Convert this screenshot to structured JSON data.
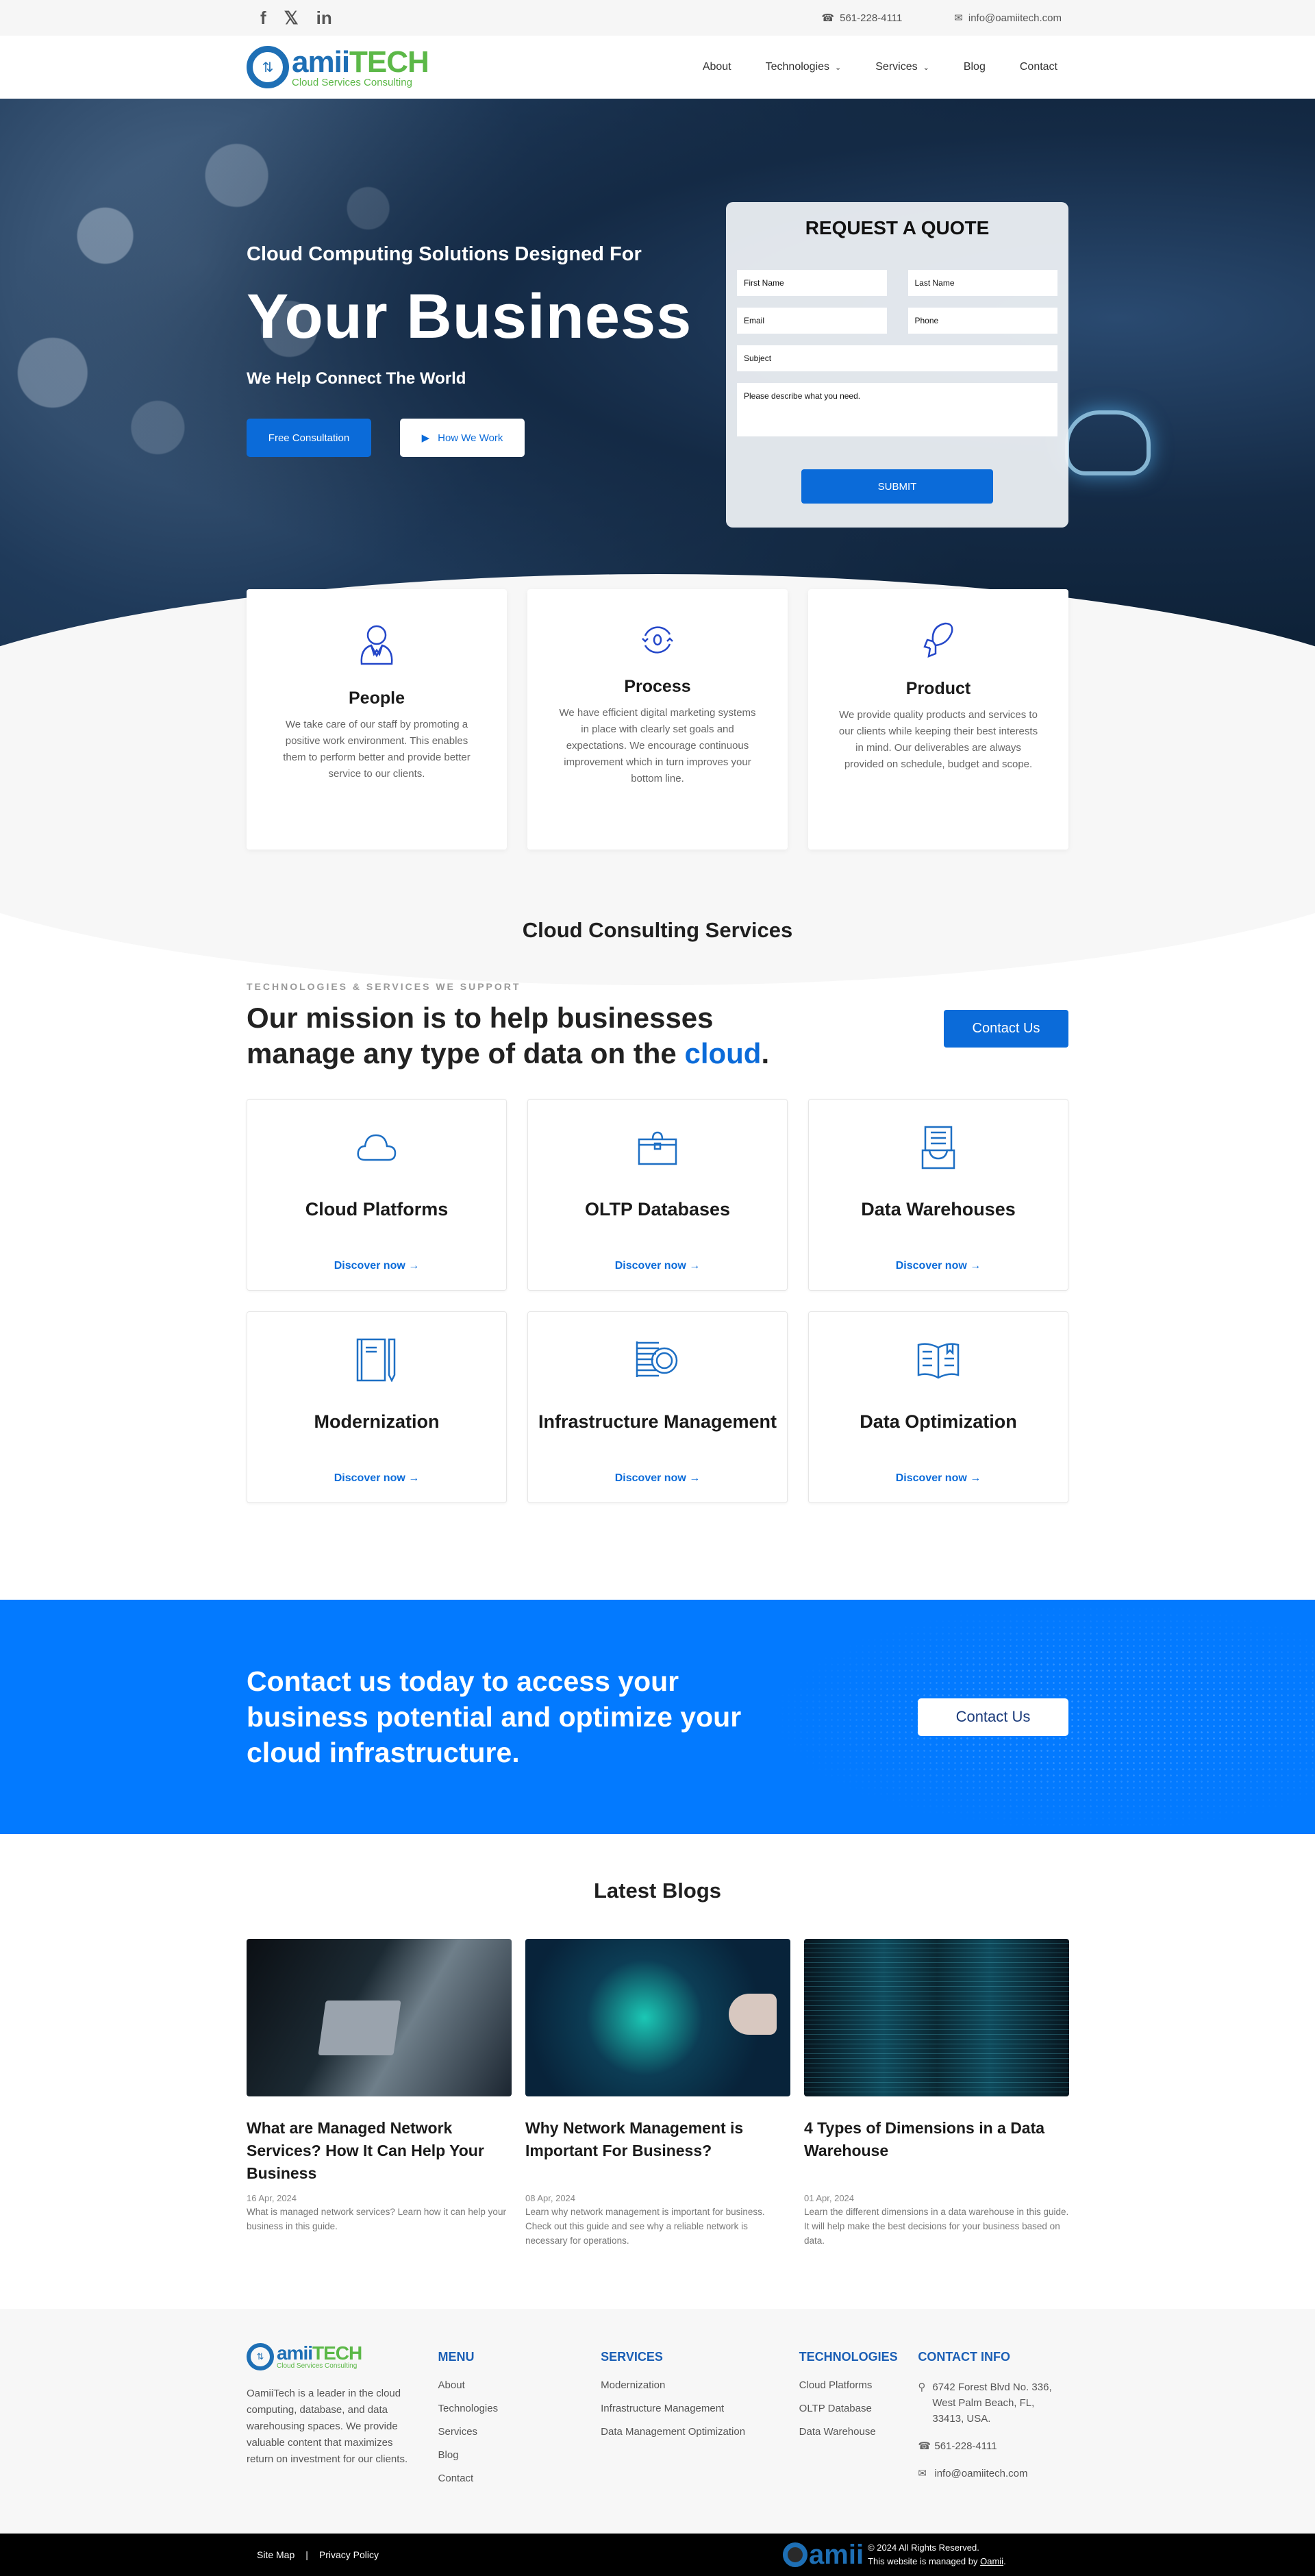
{
  "topbar": {
    "social": [
      {
        "name": "facebook-icon",
        "glyph": "f"
      },
      {
        "name": "x-twitter-icon",
        "glyph": "𝕏"
      },
      {
        "name": "linkedin-icon",
        "glyph": "in"
      }
    ],
    "phone": "561-228-4111",
    "email": "info@oamiitech.com",
    "phone_icon": "☎",
    "email_icon": "✉"
  },
  "header": {
    "logo": {
      "icon": "⇅",
      "word_a": "amii",
      "word_b": "TECH",
      "tagline": "Cloud Services Consulting"
    },
    "nav": [
      {
        "label": "About",
        "dropdown": false
      },
      {
        "label": "Technologies",
        "dropdown": true
      },
      {
        "label": "Services",
        "dropdown": true
      },
      {
        "label": "Blog",
        "dropdown": false
      },
      {
        "label": "Contact",
        "dropdown": false
      }
    ],
    "chevron": "⌄"
  },
  "hero": {
    "subtitle": "Cloud Computing Solutions Designed For",
    "title": "Your Business",
    "tagline": "We Help Connect The World",
    "btn_primary": "Free Consultation",
    "btn_secondary": "How We Work",
    "play_icon": "▶"
  },
  "quote_form": {
    "title": "REQUEST A QUOTE",
    "first_name": "First Name",
    "last_name": "Last Name",
    "email": "Email",
    "phone": "Phone",
    "subject": "Subject",
    "message": "Please describe what you need.",
    "submit": "SUBMIT"
  },
  "features": [
    {
      "title": "People",
      "text": "We take care of our staff by promoting a positive work environment. This enables them to perform better and provide better service to our clients."
    },
    {
      "title": "Process",
      "text": "We have efficient digital marketing systems in place with clearly set goals and expectations. We encourage continuous improvement which in turn improves your bottom line."
    },
    {
      "title": "Product",
      "text": "We provide quality products and services to our clients while keeping their best interests in mind. Our deliverables are always provided on schedule, budget and scope."
    }
  ],
  "services": {
    "title": "Cloud Consulting Services",
    "eyebrow": "TECHNOLOGIES & SERVICES WE SUPPORT",
    "mission_a": "Our mission is to help businesses",
    "mission_b": "manage any type of data on the ",
    "mission_highlight": "cloud",
    "mission_end": ".",
    "contact_btn": "Contact Us",
    "discover": "Discover now →",
    "items": [
      {
        "title": "Cloud Platforms",
        "icon": "cloud-icon"
      },
      {
        "title": "OLTP Databases",
        "icon": "briefcase-icon"
      },
      {
        "title": "Data Warehouses",
        "icon": "inbox-tray-icon"
      },
      {
        "title": "Modernization",
        "icon": "notebook-pencil-icon"
      },
      {
        "title": "Infrastructure Management",
        "icon": "coins-stack-icon"
      },
      {
        "title": "Data Optimization",
        "icon": "open-book-icon"
      }
    ]
  },
  "cta": {
    "text": "Contact us today to access your business potential and optimize your cloud infrastructure.",
    "button": "Contact Us"
  },
  "blogs": {
    "title": "Latest Blogs",
    "posts": [
      {
        "title": "What are Managed Network Services? How It Can Help Your Business",
        "date": "16 Apr, 2024",
        "desc": "What is managed network services? Learn how it can help your business in this guide."
      },
      {
        "title": "Why Network Management is Important For Business?",
        "date": "08 Apr, 2024",
        "desc": "Learn why network management is important for business. Check out this guide and see why a reliable network is necessary for operations."
      },
      {
        "title": "4 Types of Dimensions in a Data Warehouse",
        "date": "01 Apr, 2024",
        "desc": "Learn the different dimensions in a data warehouse in this guide. It will help make the best decisions for your business based on data."
      }
    ]
  },
  "footer": {
    "about": "OamiiTech is a leader in the cloud computing, database, and data warehousing spaces. We provide valuable content that maximizes return on investment for our clients.",
    "menu_title": "MENU",
    "menu": [
      "About",
      "Technologies",
      "Services",
      "Blog",
      "Contact"
    ],
    "services_title": "SERVICES",
    "services": [
      "Modernization",
      "Infrastructure Management",
      "Data Management Optimization"
    ],
    "tech_title": "TECHNOLOGIES",
    "tech": [
      "Cloud Platforms",
      "OLTP Database",
      "Data Warehouse"
    ],
    "contact_title": "CONTACT INFO",
    "address": "6742 Forest Blvd No. 336, West Palm Beach, FL, 33413, USA.",
    "phone": "561-228-4111",
    "email": "info@oamiitech.com",
    "pin_icon": "⚲",
    "phone_icon": "☎",
    "email_icon": "✉"
  },
  "bottom": {
    "site_map": "Site Map",
    "sep": "|",
    "privacy": "Privacy Policy",
    "agency": "amii",
    "copyright": "© 2024 All Rights Reserved.",
    "managed_prefix": "This website is managed by ",
    "managed_link": "Oamii",
    "managed_suffix": "."
  },
  "colors": {
    "brand_blue": "#0b6bd9",
    "cta_blue": "#037aff",
    "logo_blue": "#1e6fb5",
    "logo_green": "#5cb848",
    "footer_heading": "#1b5fb5"
  }
}
